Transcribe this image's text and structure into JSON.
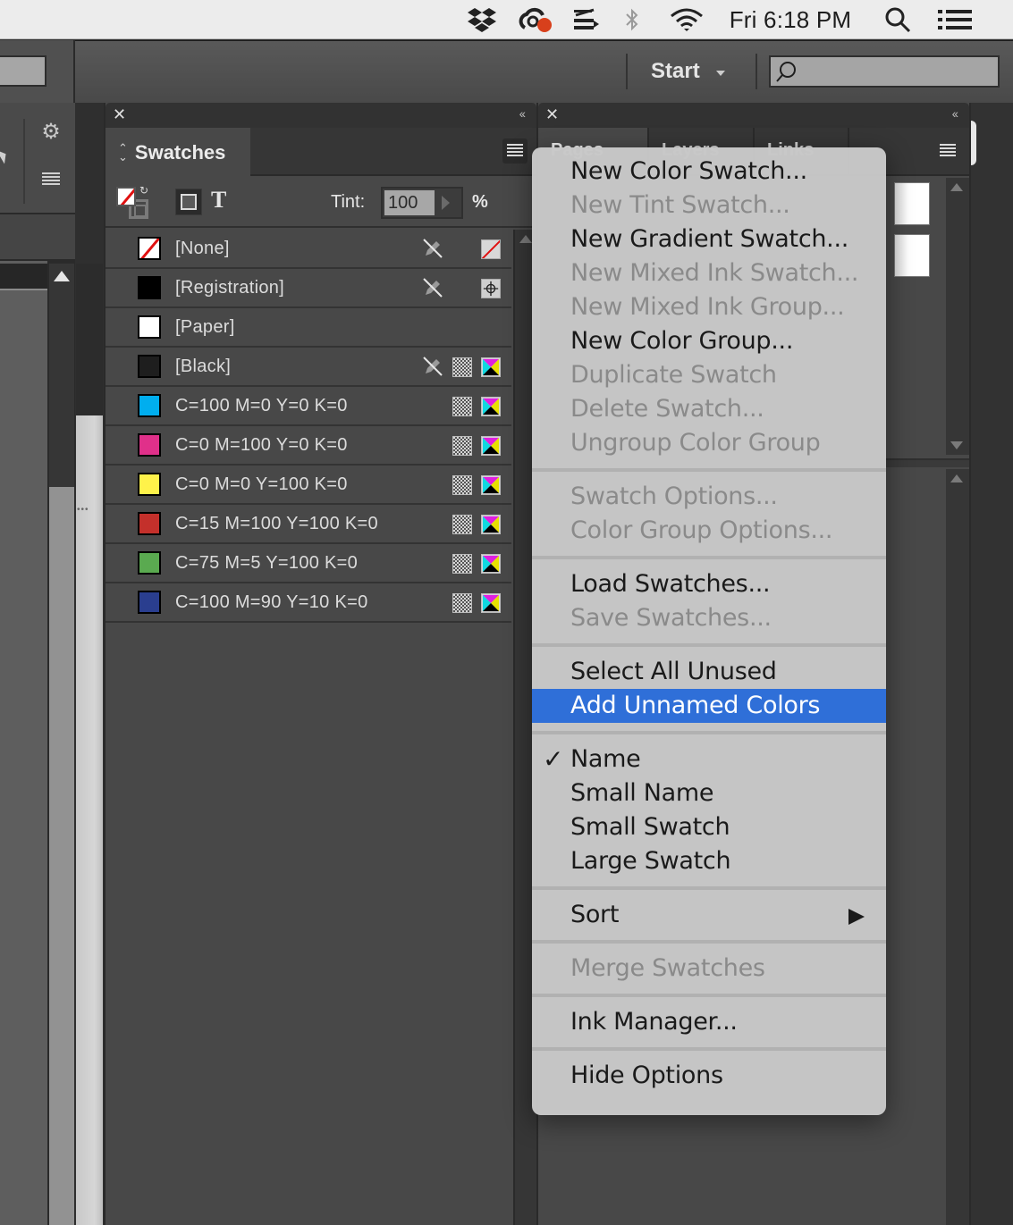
{
  "menubar": {
    "clock": "Fri 6:18 PM",
    "status_icons": [
      "dropbox-icon",
      "creative-cloud-icon",
      "scanner-icon",
      "bluetooth-icon",
      "wifi-icon"
    ],
    "spotlight_icon": "spotlight-search-icon",
    "notification_icon": "notification-center-icon"
  },
  "app_bar": {
    "workspace_label": "Start",
    "search_placeholder": ""
  },
  "swatches_panel": {
    "title": "Swatches",
    "tint_label": "Tint:",
    "tint_value": "100",
    "tint_unit": "%",
    "text_button_glyph": "T",
    "swatches": [
      {
        "name": "[None]",
        "color": "none",
        "locked": true,
        "mode": "none"
      },
      {
        "name": "[Registration]",
        "color": "#000000",
        "locked": true,
        "mode": "registration"
      },
      {
        "name": "[Paper]",
        "color": "#ffffff",
        "locked": false,
        "mode": ""
      },
      {
        "name": "[Black]",
        "color": "#1e1e1e",
        "locked": true,
        "mode": "cmyk"
      },
      {
        "name": "C=100 M=0 Y=0 K=0",
        "color": "#00aeef",
        "locked": false,
        "mode": "cmyk"
      },
      {
        "name": "C=0 M=100 Y=0 K=0",
        "color": "#e0308a",
        "locked": false,
        "mode": "cmyk"
      },
      {
        "name": "C=0 M=0 Y=100 K=0",
        "color": "#fff24a",
        "locked": false,
        "mode": "cmyk"
      },
      {
        "name": "C=15 M=100 Y=100 K=0",
        "color": "#c4302b",
        "locked": false,
        "mode": "cmyk"
      },
      {
        "name": "C=75 M=5 Y=100 K=0",
        "color": "#5aaa50",
        "locked": false,
        "mode": "cmyk"
      },
      {
        "name": "C=100 M=90 Y=10 K=0",
        "color": "#2a3e8f",
        "locked": false,
        "mode": "cmyk"
      }
    ]
  },
  "right_panel": {
    "tabs": [
      "Pages",
      "Layers",
      "Links"
    ]
  },
  "context_menu": {
    "groups": [
      [
        {
          "label": "New Color Swatch...",
          "enabled": true
        },
        {
          "label": "New Tint Swatch...",
          "enabled": false
        },
        {
          "label": "New Gradient Swatch...",
          "enabled": true
        },
        {
          "label": "New Mixed Ink Swatch...",
          "enabled": false
        },
        {
          "label": "New Mixed Ink Group...",
          "enabled": false
        },
        {
          "label": "New Color Group...",
          "enabled": true
        },
        {
          "label": "Duplicate Swatch",
          "enabled": false
        },
        {
          "label": "Delete Swatch...",
          "enabled": false
        },
        {
          "label": "Ungroup Color Group",
          "enabled": false
        }
      ],
      [
        {
          "label": "Swatch Options...",
          "enabled": false
        },
        {
          "label": "Color Group Options...",
          "enabled": false
        }
      ],
      [
        {
          "label": "Load Swatches...",
          "enabled": true
        },
        {
          "label": "Save Swatches...",
          "enabled": false
        }
      ],
      [
        {
          "label": "Select All Unused",
          "enabled": true
        },
        {
          "label": "Add Unnamed Colors",
          "enabled": true,
          "highlighted": true
        }
      ],
      [
        {
          "label": "Name",
          "enabled": true,
          "checked": true
        },
        {
          "label": "Small Name",
          "enabled": true
        },
        {
          "label": "Small Swatch",
          "enabled": true
        },
        {
          "label": "Large Swatch",
          "enabled": true
        }
      ],
      [
        {
          "label": "Sort",
          "enabled": true,
          "submenu": true
        }
      ],
      [
        {
          "label": "Merge Swatches",
          "enabled": false
        }
      ],
      [
        {
          "label": "Ink Manager...",
          "enabled": true
        }
      ],
      [
        {
          "label": "Hide Options",
          "enabled": true
        }
      ]
    ],
    "check_glyph": "✓",
    "highlight_color": "#2f6fd8"
  }
}
